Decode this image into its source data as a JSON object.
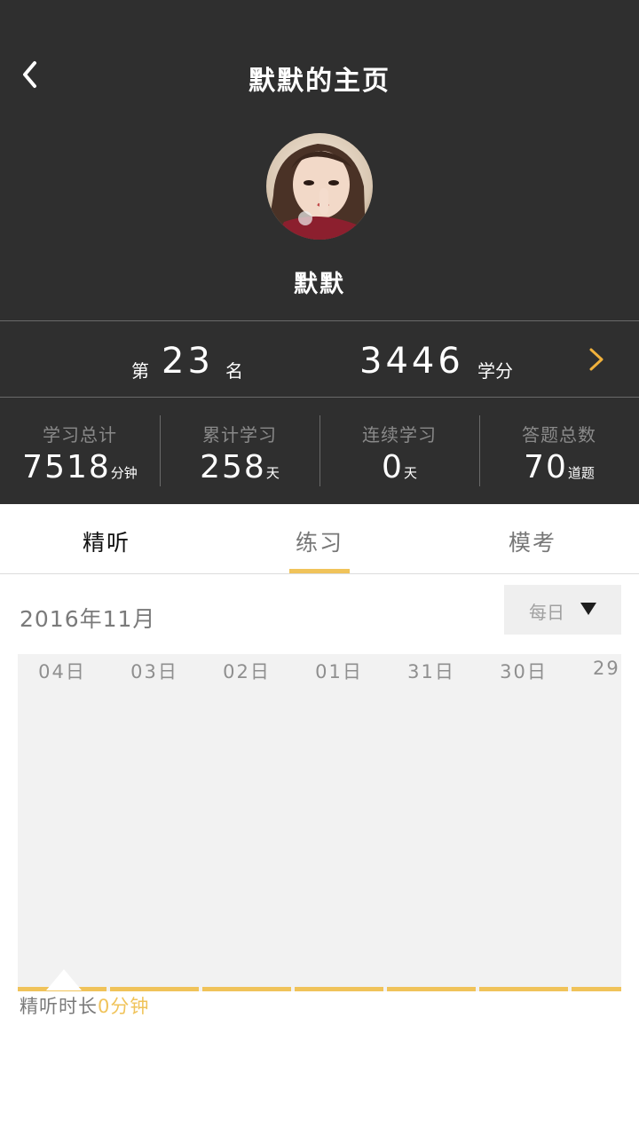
{
  "header": {
    "title": "默默的主页",
    "back_icon": "chevron-left-icon"
  },
  "profile": {
    "name": "默默",
    "avatar": "user-photo-avatar"
  },
  "ranking": {
    "prefix": "第",
    "rank": "23",
    "suffix": "名",
    "credits": "3446",
    "credits_unit": "学分",
    "chevron_color": "#f0b13c"
  },
  "stats": [
    {
      "label": "学习总计",
      "value": "7518",
      "unit": "分钟"
    },
    {
      "label": "累计学习",
      "value": "258",
      "unit": "天"
    },
    {
      "label": "连续学习",
      "value": "0",
      "unit": "天"
    },
    {
      "label": "答题总数",
      "value": "70",
      "unit": "道题"
    }
  ],
  "tabs": [
    {
      "label": "精听"
    },
    {
      "label": "练习"
    },
    {
      "label": "模考"
    }
  ],
  "calendar": {
    "month": "2016年11月",
    "period": "每日",
    "days": [
      "04日",
      "03日",
      "02日",
      "01日",
      "31日",
      "30日",
      "29"
    ]
  },
  "summary": {
    "label": "精听时长",
    "value": "0分钟"
  },
  "colors": {
    "header_bg": "#2f2f2f",
    "accent": "#f0c35a",
    "chart_bg": "#f2f2f2"
  }
}
